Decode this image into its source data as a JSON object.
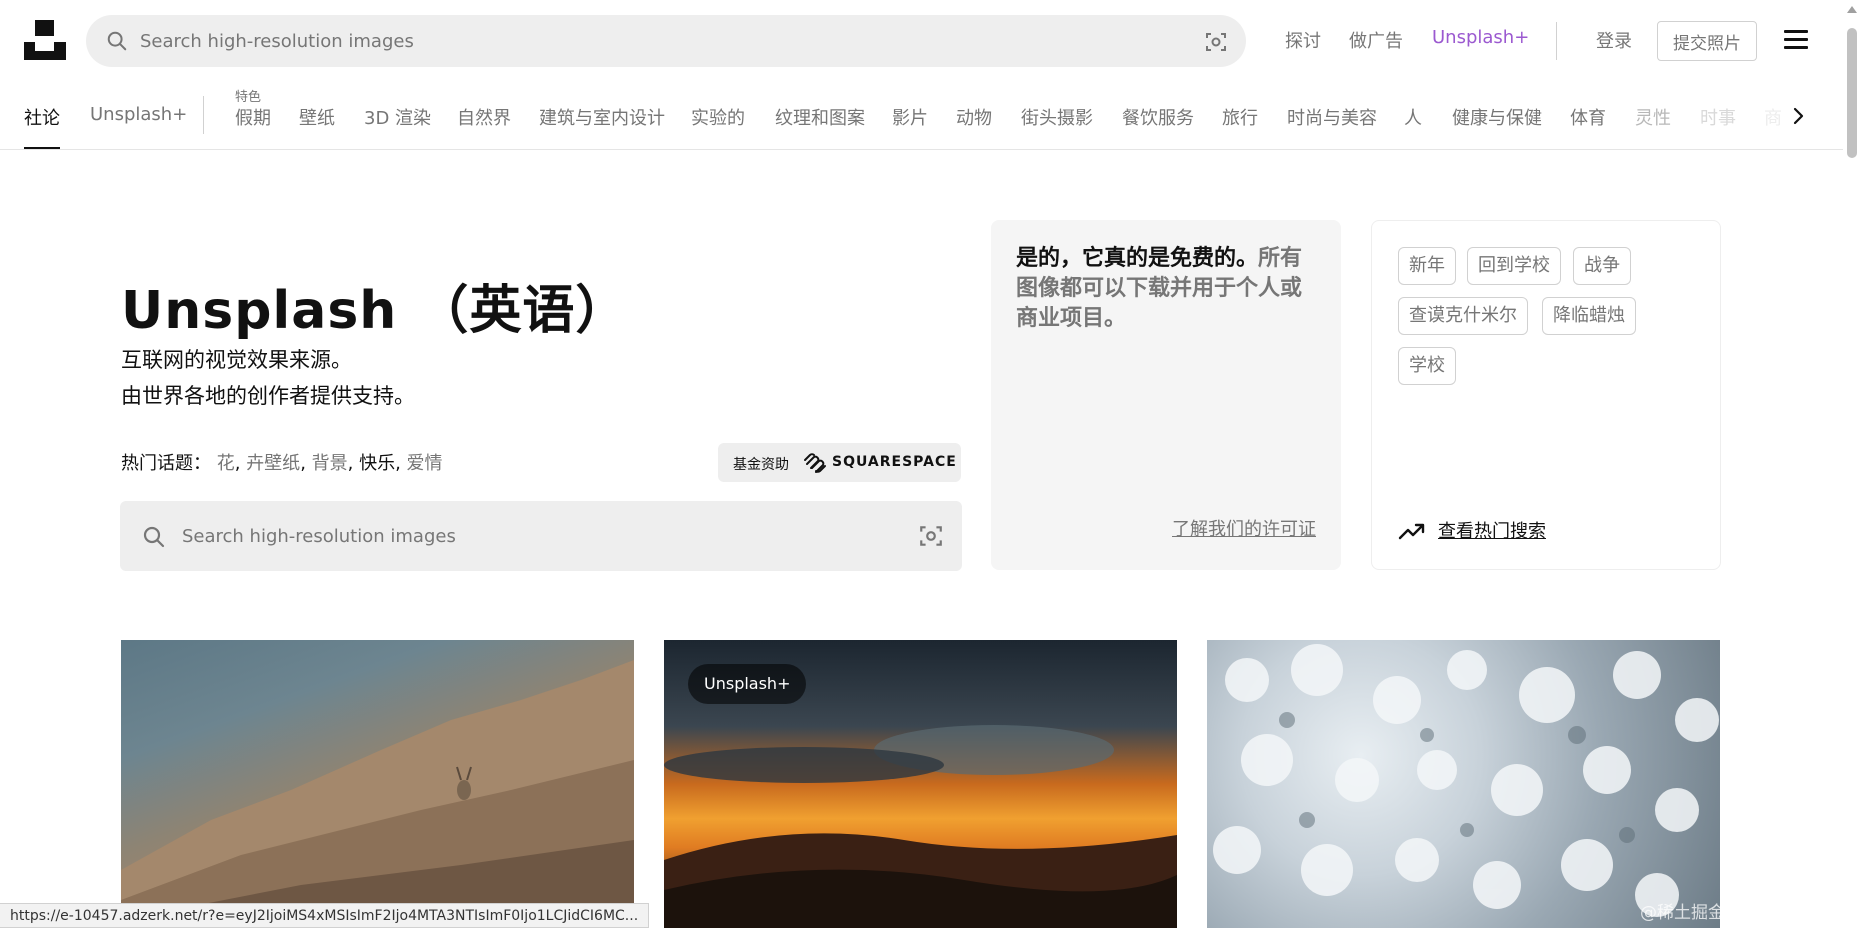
{
  "header": {
    "search_placeholder": "Search high-resolution images",
    "nav": {
      "explore": "探讨",
      "advertise": "做广告",
      "plus": "Unsplash+"
    },
    "login": "登录",
    "submit_photo": "提交照片"
  },
  "tabs": {
    "featured_label": "特色",
    "items": [
      "社论",
      "Unsplash+",
      "假期",
      "壁纸",
      "3D 渲染",
      "自然界",
      "建筑与室内设计",
      "实验的",
      "纹理和图案",
      "影片",
      "动物",
      "街头摄影",
      "餐饮服务",
      "旅行",
      "时尚与美容",
      "人",
      "健康与保健",
      "体育",
      "灵性",
      "时事",
      "商"
    ]
  },
  "hero": {
    "title": "Unsplash （英语）",
    "subtitle_line1": "互联网的视觉效果来源。",
    "subtitle_line2": "由世界各地的创作者提供支持。",
    "trending_label": "热门话题：",
    "trending_items": [
      "花",
      "卉壁纸",
      "背景",
      "快乐",
      "爱情"
    ],
    "sponsor_label": "基金资助",
    "sponsor_name": "SQUARESPACE",
    "search_placeholder": "Search high-resolution images"
  },
  "license_card": {
    "bold_text": "是的，它真的是免费的。",
    "rest_text": "所有图像都可以下载并用于个人或商业项目。",
    "link": "了解我们的许可证"
  },
  "trend_card": {
    "chips": [
      "新年",
      "回到学校",
      "战争",
      "查谟克什米尔",
      "降临蜡烛",
      "学校"
    ],
    "link": "查看热门搜索"
  },
  "photos": {
    "plus_badge": "Unsplash+"
  },
  "status_bar": {
    "url": "https://e-10457.adzerk.net/r?e=eyJ2IjoiMS4xMSIsImF2Ijo4MTA3NTIsImF0Ijo1LCJidCI6MC..."
  },
  "watermark": "@稀土掘金技术社区",
  "colors": {
    "accent_plus": "#9b59d0",
    "muted_text": "#767676",
    "search_bg": "#eeeeee"
  }
}
